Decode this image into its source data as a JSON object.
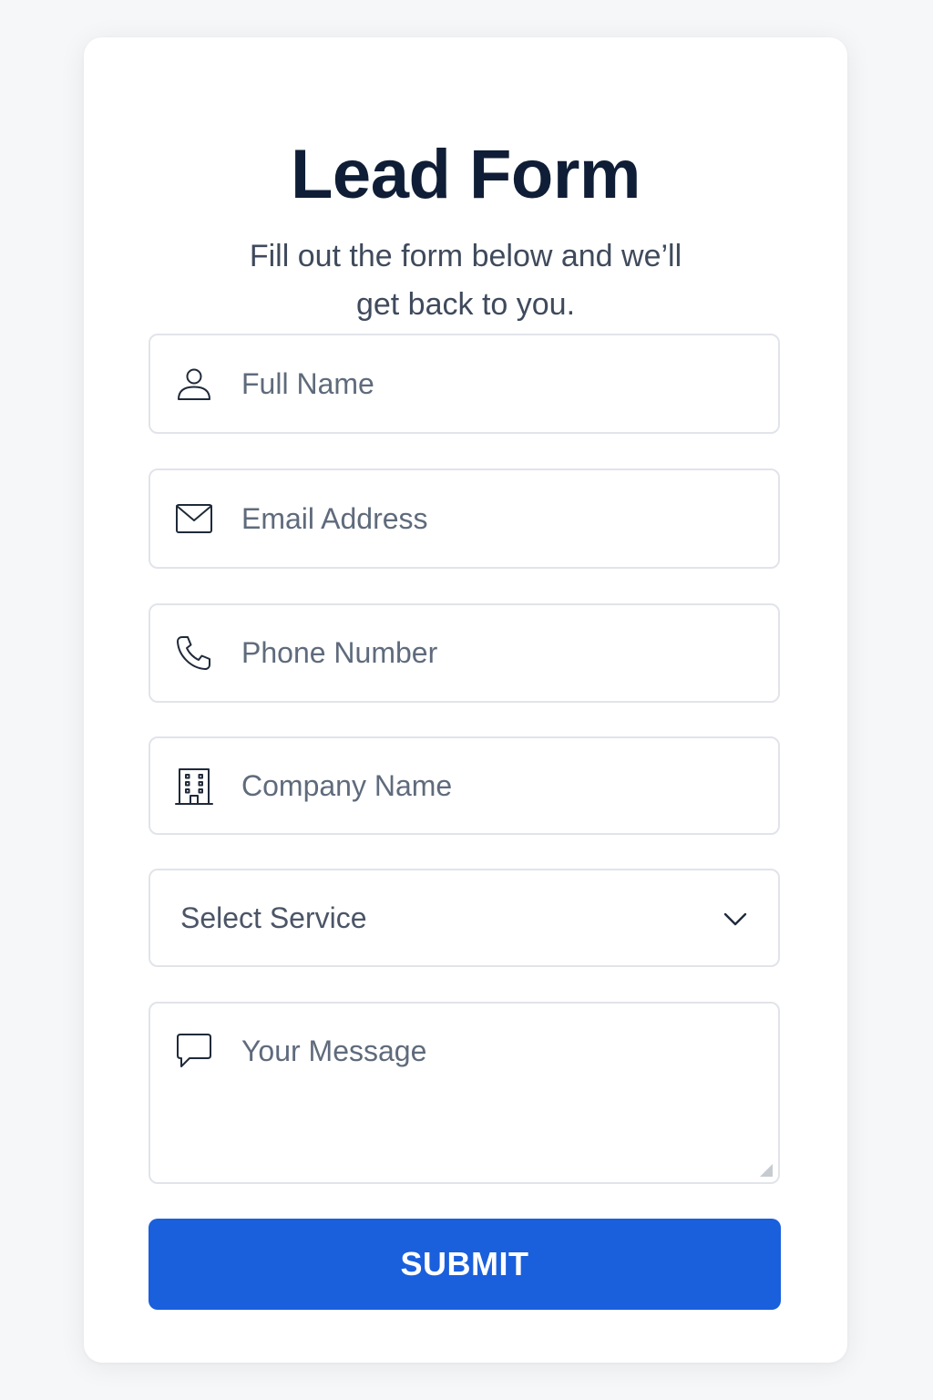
{
  "form": {
    "title": "Lead Form",
    "subtitle": "Fill out the form below and we’ll get back to you.",
    "fields": {
      "full_name": {
        "placeholder": "Full Name",
        "value": "",
        "icon": "person-icon"
      },
      "email": {
        "placeholder": "Email Address",
        "value": "",
        "icon": "mail-icon"
      },
      "phone": {
        "placeholder": "Phone Number",
        "value": "",
        "icon": "phone-icon"
      },
      "company": {
        "placeholder": "Company Name",
        "value": "",
        "icon": "building-icon"
      },
      "service": {
        "selected": "Select Service",
        "icon": "chevron-down-icon"
      },
      "message": {
        "placeholder": "Your Message",
        "value": "",
        "icon": "chat-bubble-icon"
      }
    },
    "submit_label": "SUBMIT"
  },
  "colors": {
    "accent": "#1a5fdc",
    "title": "#0f1e36",
    "border": "#e1e4e9",
    "background": "#f6f7f8"
  }
}
